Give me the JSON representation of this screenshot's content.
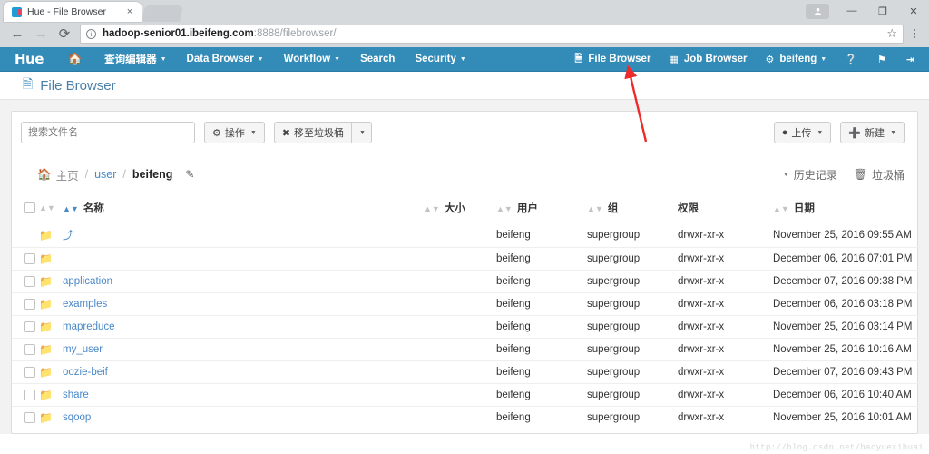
{
  "browser": {
    "tab": {
      "title": "Hue - File Browser",
      "favicon": "hue-favicon",
      "close_label": "×"
    },
    "window_controls": {
      "profile": "▲",
      "minimize": "—",
      "maximize": "❐",
      "close": "✕"
    },
    "nav": {
      "back": "←",
      "forward": "→",
      "reload": "⟳"
    },
    "omnibox": {
      "info_icon": "i",
      "url_host": "hadoop-senior01.ibeifeng.com",
      "url_rest": ":8888/filebrowser/",
      "star_icon": "☆"
    }
  },
  "hue_nav": {
    "logo": "Hue",
    "left_items": [
      {
        "label": "",
        "icon": "home-icon",
        "caret": false
      },
      {
        "label": "查询编辑器",
        "caret": true
      },
      {
        "label": "Data Browser",
        "caret": true
      },
      {
        "label": "Workflow",
        "caret": true
      },
      {
        "label": "Search",
        "caret": false
      },
      {
        "label": "Security",
        "caret": true
      }
    ],
    "right_items": [
      {
        "label": "File Browser",
        "icon": "file-icon",
        "caret": false
      },
      {
        "label": "Job Browser",
        "icon": "grid-icon",
        "caret": false
      },
      {
        "label": "beifeng",
        "icon": "gear-icon",
        "caret": true
      },
      {
        "label": "",
        "icon": "help-icon",
        "caret": false
      },
      {
        "label": "",
        "icon": "flag-icon",
        "caret": false
      },
      {
        "label": "",
        "icon": "logout-icon",
        "caret": false
      }
    ],
    "bg_color": "#338bb8"
  },
  "page": {
    "title": "File Browser",
    "title_icon": "document-icon"
  },
  "toolbar": {
    "search_placeholder": "搜索文件名",
    "search_value": "",
    "actions_label": "操作",
    "trash_label": "移至垃圾桶",
    "upload_label": "上传",
    "new_label": "新建"
  },
  "breadcrumb": {
    "home_label": "主页",
    "sep": "/",
    "parts": [
      {
        "label": "user",
        "current": false
      },
      {
        "label": "beifeng",
        "current": true
      }
    ],
    "edit_icon": "pencil-icon",
    "history_label": "历史记录",
    "trash_label": "垃圾桶"
  },
  "table": {
    "columns": [
      {
        "key": "name",
        "label": "名称",
        "sortable": true,
        "sorted": true
      },
      {
        "key": "size",
        "label": "大小",
        "sortable": true,
        "sorted": false
      },
      {
        "key": "user",
        "label": "用户",
        "sortable": true,
        "sorted": false
      },
      {
        "key": "group",
        "label": "组",
        "sortable": true,
        "sorted": false
      },
      {
        "key": "perm",
        "label": "权限",
        "sortable": false,
        "sorted": false
      },
      {
        "key": "date",
        "label": "日期",
        "sortable": true,
        "sorted": false
      }
    ],
    "rows": [
      {
        "name": "⤴",
        "kind": "parent",
        "checkbox": false,
        "size": "",
        "user": "beifeng",
        "group": "supergroup",
        "perm": "drwxr-xr-x",
        "date": "November 25, 2016 09:55 AM"
      },
      {
        "name": ".",
        "kind": "current",
        "checkbox": true,
        "size": "",
        "user": "beifeng",
        "group": "supergroup",
        "perm": "drwxr-xr-x",
        "date": "December 06, 2016 07:01 PM"
      },
      {
        "name": "application",
        "kind": "dir",
        "checkbox": true,
        "size": "",
        "user": "beifeng",
        "group": "supergroup",
        "perm": "drwxr-xr-x",
        "date": "December 07, 2016 09:38 PM"
      },
      {
        "name": "examples",
        "kind": "dir",
        "checkbox": true,
        "size": "",
        "user": "beifeng",
        "group": "supergroup",
        "perm": "drwxr-xr-x",
        "date": "December 06, 2016 03:18 PM"
      },
      {
        "name": "mapreduce",
        "kind": "dir",
        "checkbox": true,
        "size": "",
        "user": "beifeng",
        "group": "supergroup",
        "perm": "drwxr-xr-x",
        "date": "November 25, 2016 03:14 PM"
      },
      {
        "name": "my_user",
        "kind": "dir",
        "checkbox": true,
        "size": "",
        "user": "beifeng",
        "group": "supergroup",
        "perm": "drwxr-xr-x",
        "date": "November 25, 2016 10:16 AM"
      },
      {
        "name": "oozie-beif",
        "kind": "dir",
        "checkbox": true,
        "size": "",
        "user": "beifeng",
        "group": "supergroup",
        "perm": "drwxr-xr-x",
        "date": "December 07, 2016 09:43 PM"
      },
      {
        "name": "share",
        "kind": "dir",
        "checkbox": true,
        "size": "",
        "user": "beifeng",
        "group": "supergroup",
        "perm": "drwxr-xr-x",
        "date": "December 06, 2016 10:40 AM"
      },
      {
        "name": "sqoop",
        "kind": "dir",
        "checkbox": true,
        "size": "",
        "user": "beifeng",
        "group": "supergroup",
        "perm": "drwxr-xr-x",
        "date": "November 25, 2016 10:01 AM"
      }
    ]
  },
  "annotation": {
    "arrow_color": "#ee2b2b",
    "points_to": "File Browser"
  },
  "watermark": {
    "text": "http://blog.csdn.net/haoyuexihuai"
  }
}
